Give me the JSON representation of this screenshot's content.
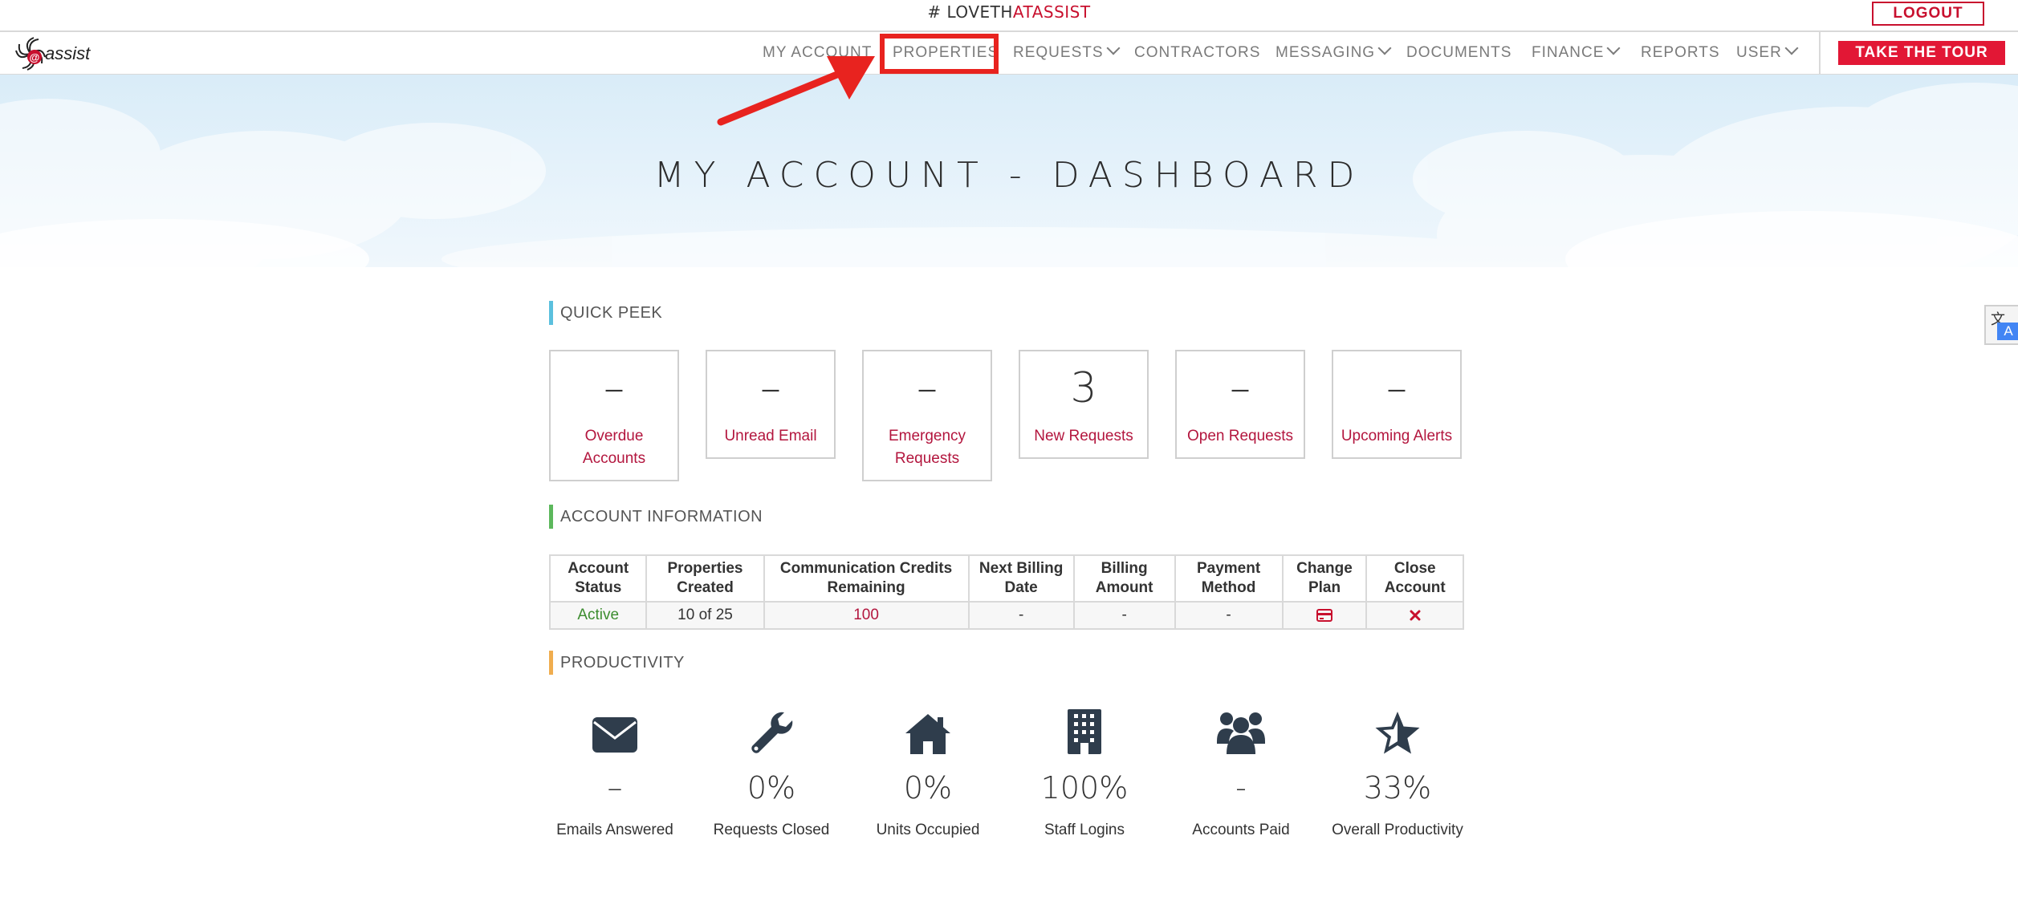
{
  "topbar": {
    "hashtag_prefix": "# LOVETH",
    "hashtag_accent": "ATASSIST",
    "logout_label": "LOGOUT"
  },
  "brand": {
    "logo_text": "assist",
    "logo_mark": "at"
  },
  "nav": {
    "items": [
      {
        "label": "MY ACCOUNT",
        "dropdown": false
      },
      {
        "label": "PROPERTIES",
        "dropdown": false
      },
      {
        "label": "REQUESTS",
        "dropdown": true
      },
      {
        "label": "CONTRACTORS",
        "dropdown": false
      },
      {
        "label": "MESSAGING",
        "dropdown": true
      },
      {
        "label": "DOCUMENTS",
        "dropdown": false
      },
      {
        "label": "FINANCE",
        "dropdown": true
      },
      {
        "label": "REPORTS",
        "dropdown": false
      },
      {
        "label": "USER",
        "dropdown": true
      }
    ],
    "tour_label": "TAKE THE TOUR"
  },
  "hero": {
    "title": "MY ACCOUNT - DASHBOARD"
  },
  "quick_peek": {
    "title": "QUICK PEEK",
    "cards": [
      {
        "value": "–",
        "label": "Overdue Accounts"
      },
      {
        "value": "–",
        "label": "Unread Email"
      },
      {
        "value": "–",
        "label": "Emergency Requests"
      },
      {
        "value": "3",
        "label": "New Requests"
      },
      {
        "value": "–",
        "label": "Open Requests"
      },
      {
        "value": "–",
        "label": "Upcoming Alerts"
      }
    ]
  },
  "account_info": {
    "title": "ACCOUNT INFORMATION",
    "headers": [
      "Account Status",
      "Properties Created",
      "Communication Credits Remaining",
      "Next Billing Date",
      "Billing Amount",
      "Payment Method",
      "Change Plan",
      "Close Account"
    ],
    "row": {
      "status": "Active",
      "properties": "10 of 25",
      "credits": "100",
      "next_billing": "-",
      "billing_amount": "-",
      "payment_method": "-",
      "change_plan_icon": "credit-card-icon",
      "close_account_icon": "close-x-icon"
    }
  },
  "productivity": {
    "title": "PRODUCTIVITY",
    "items": [
      {
        "icon": "envelope-icon",
        "value": "–",
        "label": "Emails Answered"
      },
      {
        "icon": "wrench-icon",
        "value": "0%",
        "label": "Requests Closed"
      },
      {
        "icon": "home-icon",
        "value": "0%",
        "label": "Units Occupied"
      },
      {
        "icon": "building-icon",
        "value": "100%",
        "label": "Staff Logins"
      },
      {
        "icon": "users-icon",
        "value": "-",
        "label": "Accounts Paid"
      },
      {
        "icon": "star-icon",
        "value": "33%",
        "label": "Overall Productivity"
      }
    ]
  },
  "colors": {
    "accent_red": "#c8102e",
    "tour_red": "#e21735",
    "highlight_red": "#e8231f",
    "label_crimson": "#b3163e",
    "active_green": "#3c8d2f",
    "bar_quick_peek": "#5bc0de",
    "bar_account_info": "#5cb85c",
    "bar_productivity": "#f0ad4e",
    "icon_dark": "#2f3d4c"
  }
}
